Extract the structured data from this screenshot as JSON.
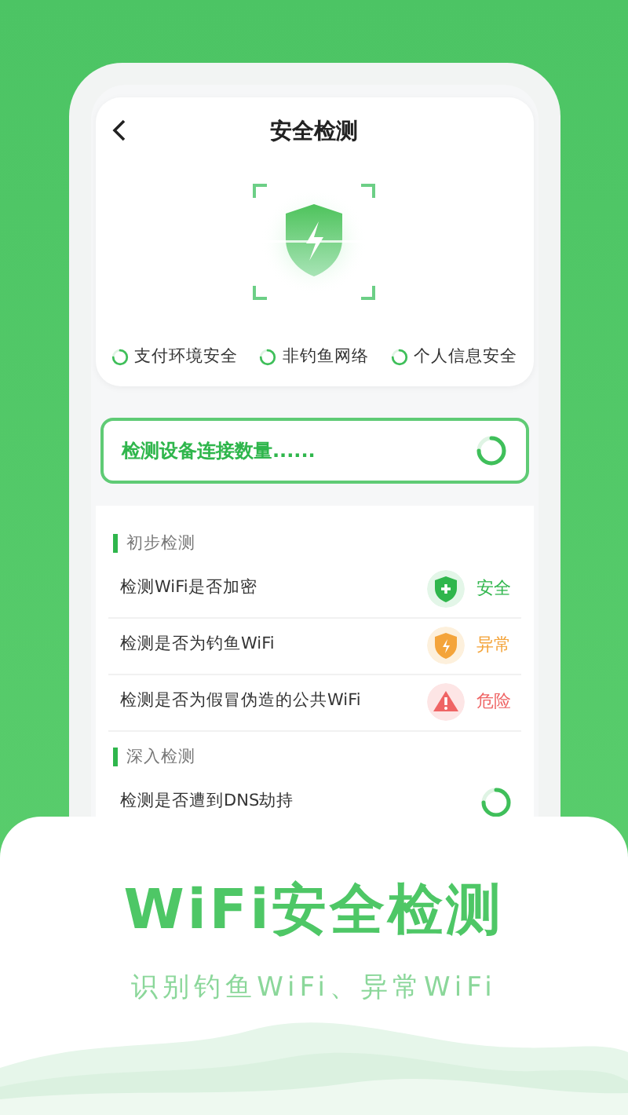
{
  "screen": {
    "title": "安全检测",
    "checks": [
      {
        "label": "支付环境安全"
      },
      {
        "label": "非钓鱼网络"
      },
      {
        "label": "个人信息安全"
      }
    ],
    "scan_status": "检测设备连接数量......",
    "sections": [
      {
        "title": "初步检测",
        "items": [
          {
            "label": "检测WiFi是否加密",
            "kind": "safe",
            "result": "安全"
          },
          {
            "label": "检测是否为钓鱼WiFi",
            "kind": "warning",
            "result": "异常"
          },
          {
            "label": "检测是否为假冒伪造的公共WiFi",
            "kind": "danger",
            "result": "危险"
          }
        ]
      },
      {
        "title": "深入检测",
        "items": [
          {
            "label": "检测是否遭到DNS劫持",
            "kind": "scanning"
          }
        ]
      }
    ]
  },
  "banner": {
    "headline": "WiFi安全检测",
    "subline": "识别钓鱼WiFi、异常WiFi"
  }
}
